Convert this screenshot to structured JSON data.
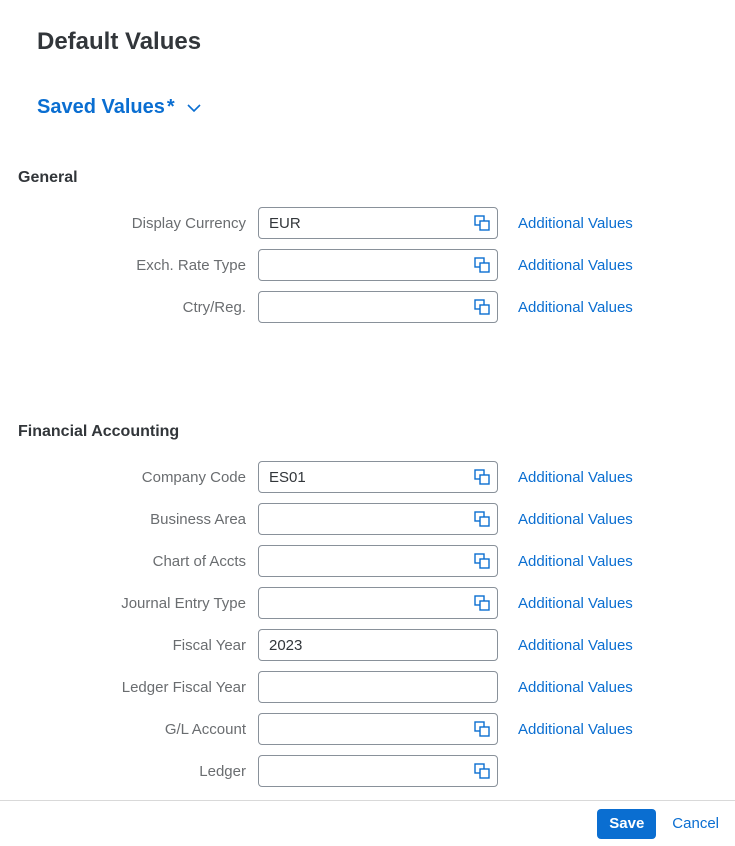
{
  "page": {
    "title": "Default Values",
    "saved_values_label": "Saved Values"
  },
  "sections": {
    "general": {
      "title": "General",
      "display_currency": {
        "label": "Display Currency",
        "value": "EUR",
        "additional": "Additional Values"
      },
      "exch_rate_type": {
        "label": "Exch. Rate Type",
        "value": "",
        "additional": "Additional Values"
      },
      "ctry_reg": {
        "label": "Ctry/Reg.",
        "value": "",
        "additional": "Additional Values"
      }
    },
    "fa": {
      "title": "Financial Accounting",
      "company_code": {
        "label": "Company Code",
        "value": "ES01",
        "additional": "Additional Values"
      },
      "business_area": {
        "label": "Business Area",
        "value": "",
        "additional": "Additional Values"
      },
      "chart_of_accts": {
        "label": "Chart of Accts",
        "value": "",
        "additional": "Additional Values"
      },
      "journal_entry_type": {
        "label": "Journal Entry Type",
        "value": "",
        "additional": "Additional Values"
      },
      "fiscal_year": {
        "label": "Fiscal Year",
        "value": "2023",
        "additional": "Additional Values"
      },
      "ledger_fiscal_year": {
        "label": "Ledger Fiscal Year",
        "value": "",
        "additional": "Additional Values"
      },
      "gl_account": {
        "label": "G/L Account",
        "value": "",
        "additional": "Additional Values"
      },
      "ledger": {
        "label": "Ledger",
        "value": ""
      }
    }
  },
  "footer": {
    "save": "Save",
    "cancel": "Cancel"
  }
}
